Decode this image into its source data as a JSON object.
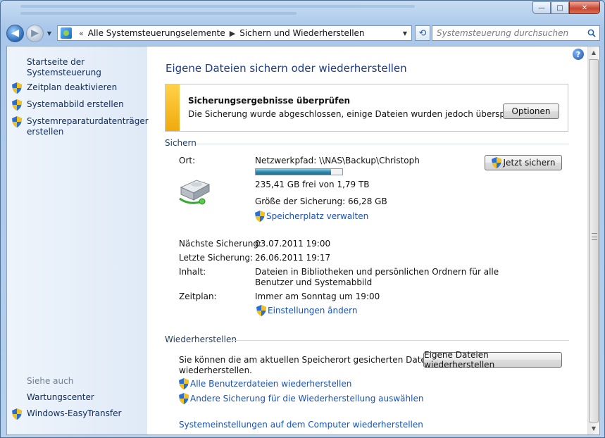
{
  "window": {
    "caption_buttons": {
      "minimize": "—",
      "maximize": "□",
      "close": "✕"
    }
  },
  "nav": {
    "back_icon": "back-arrow-icon",
    "forward_icon": "forward-arrow-icon",
    "breadcrumb_overflow": "«",
    "breadcrumbs": [
      "Alle Systemsteuerungselemente",
      "Sichern und Wiederherstellen"
    ],
    "refresh_glyph": "⟲",
    "search_placeholder": "Systemsteuerung durchsuchen"
  },
  "sidebar": {
    "home_link": "Startseite der Systemsteuerung",
    "tasks": [
      {
        "label": "Zeitplan deaktivieren",
        "icon": "uac-shield-icon"
      },
      {
        "label": "Systemabbild erstellen",
        "icon": "uac-shield-icon"
      },
      {
        "label_line1": "Systemreparaturdatenträger",
        "label_line2": "erstellen",
        "icon": "uac-shield-icon"
      }
    ],
    "see_also_heading": "Siehe auch",
    "see_also": [
      {
        "label": "Wartungscenter"
      },
      {
        "label": "Windows-EasyTransfer",
        "icon": "uac-shield-icon"
      }
    ]
  },
  "main": {
    "title": "Eigene Dateien sichern oder wiederherstellen",
    "notice": {
      "title": "Sicherungsergebnisse überprüfen",
      "text": "Die Sicherung wurde abgeschlossen, einige Dateien wurden jedoch übersprungen.",
      "button": "Optionen",
      "accent_color": "#f5b51f"
    },
    "backup": {
      "heading": "Sichern",
      "location_label": "Ort:",
      "location_value": "Netzwerkpfad: \\\\NAS\\Backup\\Christoph",
      "free_space": "235,41 GB frei von 1,79 TB",
      "used_fraction": 0.87,
      "backup_size": "Größe der Sicherung: 66,28 GB",
      "manage_link": "Speicherplatz verwalten",
      "backup_now_button": "Jetzt sichern",
      "next_label": "Nächste Sicherung:",
      "next_value": "03.07.2011 19:00",
      "last_label": "Letzte Sicherung:",
      "last_value": "26.06.2011 19:17",
      "content_label": "Inhalt:",
      "content_line1": "Dateien in Bibliotheken und persönlichen Ordnern für alle",
      "content_line2": "Benutzer und Systemabbild",
      "schedule_label": "Zeitplan:",
      "schedule_value": "Immer am Sonntag um 19:00",
      "settings_link": "Einstellungen ändern"
    },
    "restore": {
      "heading": "Wiederherstellen",
      "text_line1": "Sie können die am aktuellen Speicherort gesicherten Dateien",
      "text_line2": "wiederherstellen.",
      "restore_button": "Eigene Dateien wiederherstellen",
      "all_users_link": "Alle Benutzerdateien wiederherstellen",
      "other_backup_link": "Andere Sicherung für die Wiederherstellung auswählen",
      "system_settings_link": "Systemeinstellungen auf dem Computer wiederherstellen"
    },
    "help_glyph": "?"
  }
}
